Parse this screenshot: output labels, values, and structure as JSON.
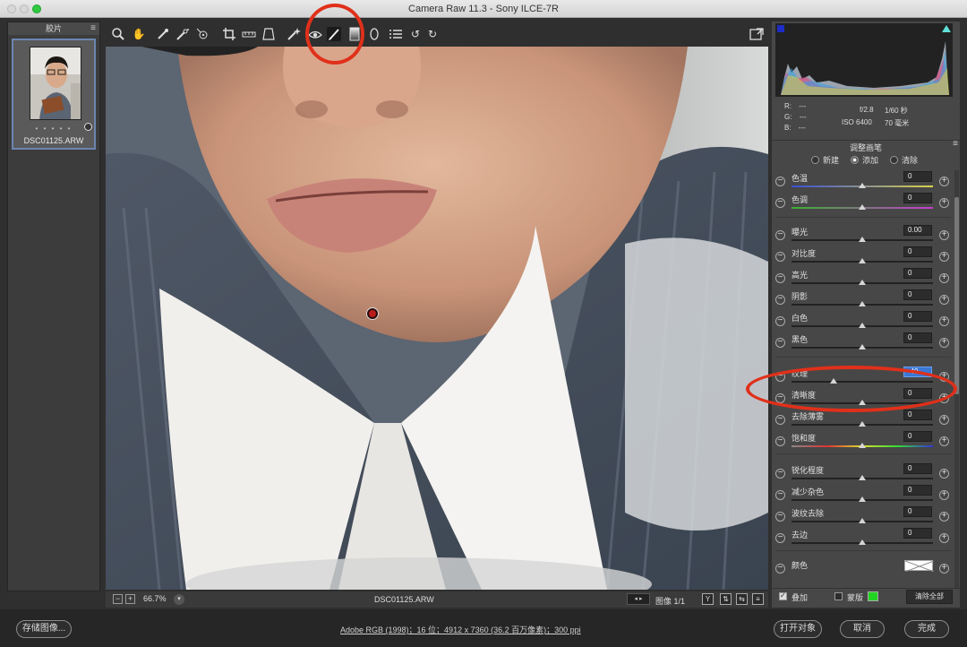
{
  "window": {
    "title": "Camera Raw 11.3 -  Sony ILCE-7R"
  },
  "filmstrip": {
    "header": "胶片",
    "menu_icon": "hamburger-menu-icon",
    "item": {
      "filename": "DSC01125.ARW",
      "rating_dots": "• • • • •"
    }
  },
  "toolbar": {
    "tools": [
      "zoom-icon",
      "hand-icon",
      "white-balance-icon",
      "color-sampler-icon",
      "target-adjust-icon",
      "crop-icon",
      "straighten-icon",
      "transform-icon",
      "spot-removal-icon",
      "red-eye-icon",
      "adjustment-brush-icon",
      "graduated-filter-icon",
      "radial-filter-icon",
      "preferences-icon",
      "rotate-ccw-icon",
      "rotate-cw-icon"
    ],
    "active_tool": "adjustment-brush-icon"
  },
  "statusbar": {
    "zoom_out": "−",
    "zoom_in": "+",
    "zoom": "66.7%",
    "zoom_dropdown": "▾",
    "filename": "DSC01125.ARW",
    "nav": "◂  ▸",
    "image_count": "图像 1/1",
    "view_y": "Y",
    "view_swap": "⇅",
    "view_copy": "⇆",
    "view_settings": "≡"
  },
  "info": {
    "r_label": "R:",
    "r_val": "---",
    "g_label": "G:",
    "g_val": "---",
    "b_label": "B:",
    "b_val": "---",
    "aperture": "f/2.8",
    "shutter": "1/60 秒",
    "iso": "ISO 6400",
    "focal": "70 毫米"
  },
  "panel": {
    "title": "调整画笔",
    "modes": {
      "new": "新建",
      "add": "添加",
      "clear": "清除",
      "selected": "add"
    },
    "sliders": [
      {
        "label": "色温",
        "value": "0",
        "track": "temp",
        "pos": 0.5
      },
      {
        "label": "色调",
        "value": "0",
        "track": "tint",
        "pos": 0.5
      },
      {
        "label": "曝光",
        "value": "0.00",
        "track": "plain",
        "pos": 0.5
      },
      {
        "label": "对比度",
        "value": "0",
        "track": "plain",
        "pos": 0.5
      },
      {
        "label": "高光",
        "value": "0",
        "track": "plain",
        "pos": 0.5
      },
      {
        "label": "阴影",
        "value": "0",
        "track": "plain",
        "pos": 0.5
      },
      {
        "label": "白色",
        "value": "0",
        "track": "plain",
        "pos": 0.5
      },
      {
        "label": "黑色",
        "value": "0",
        "track": "plain",
        "pos": 0.5
      },
      {
        "label": "纹理",
        "value": "-40",
        "track": "plain",
        "pos": 0.3,
        "selected": true
      },
      {
        "label": "清晰度",
        "value": "0",
        "track": "plain",
        "pos": 0.5
      },
      {
        "label": "去除薄雾",
        "value": "0",
        "track": "plain",
        "pos": 0.5
      },
      {
        "label": "饱和度",
        "value": "0",
        "track": "sat",
        "pos": 0.5
      },
      {
        "label": "锐化程度",
        "value": "0",
        "track": "plain",
        "pos": 0.5
      },
      {
        "label": "减少杂色",
        "value": "0",
        "track": "plain",
        "pos": 0.5
      },
      {
        "label": "波纹去除",
        "value": "0",
        "track": "plain",
        "pos": 0.5
      },
      {
        "label": "去边",
        "value": "0",
        "track": "plain",
        "pos": 0.5
      },
      {
        "label": "颜色",
        "value": "",
        "track": "none",
        "pos": 0
      }
    ],
    "overlay_label": "叠加",
    "overlay_checked": true,
    "mask_label": "蒙版",
    "mask_checked": false,
    "mask_color": "#22d422",
    "clear_all": "清除全部"
  },
  "footer": {
    "save_button": "存储图像...",
    "file_info": "Adobe RGB (1998)；16 位；4912 x 7360 (36.2 百万像素)；300 ppi",
    "open_button": "打开对象",
    "cancel_button": "取消",
    "done_button": "完成"
  },
  "colors": {
    "accent": "#3a78d6",
    "annotation": "#e0301a",
    "panel_bg": "#474747"
  }
}
